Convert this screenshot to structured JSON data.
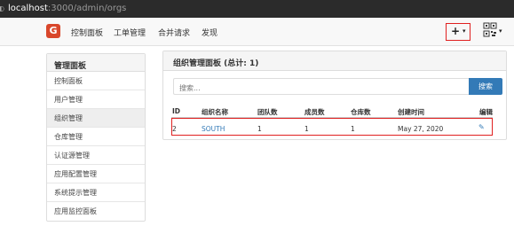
{
  "browser": {
    "url_host": "localhost",
    "url_path": ":3000/admin/orgs"
  },
  "navbar": {
    "logo_letter": "G",
    "items": [
      "控制面板",
      "工单管理",
      "合并请求",
      "发现"
    ],
    "plus_label": "+",
    "caret": "▾"
  },
  "sidebar": {
    "title": "管理面板",
    "items": [
      "控制面板",
      "用户管理",
      "组织管理",
      "仓库管理",
      "认证源管理",
      "应用配置管理",
      "系统提示管理",
      "应用监控面板"
    ],
    "active_index": 2
  },
  "main": {
    "title": "组织管理面板 (总计: 1)",
    "search_placeholder": "搜索...",
    "search_button": "搜索",
    "columns": [
      "ID",
      "组织名称",
      "团队数",
      "成员数",
      "仓库数",
      "创建时间",
      "编辑"
    ],
    "rows": [
      {
        "id": "2",
        "name": "SOUTH",
        "teams": "1",
        "members": "1",
        "repos": "1",
        "created": "May 27, 2020",
        "edit_icon": "edit-icon"
      }
    ]
  },
  "colors": {
    "accent": "#337ab7",
    "highlight": "#e02020",
    "logo": "#d9472b"
  }
}
